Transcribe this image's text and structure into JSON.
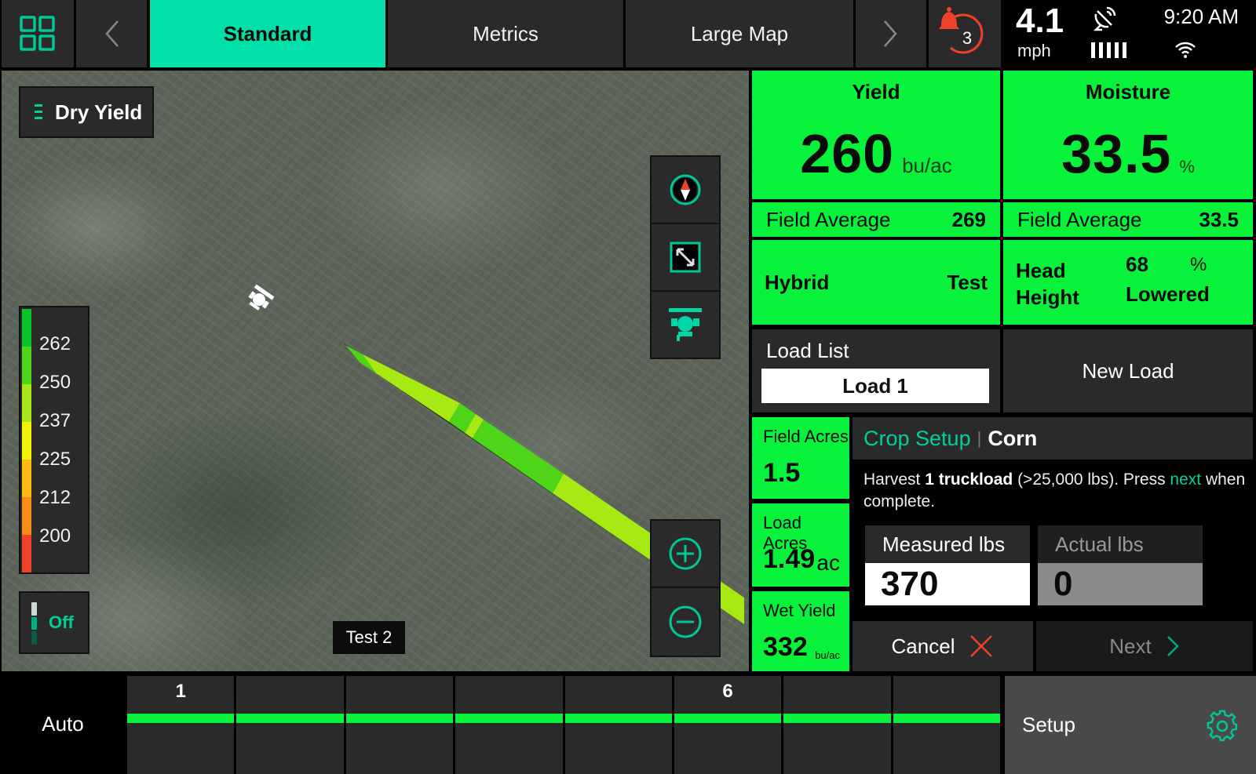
{
  "topbar": {
    "tabs": [
      {
        "label": "Standard",
        "active": true
      },
      {
        "label": "Metrics",
        "active": false
      },
      {
        "label": "Large Map",
        "active": false
      }
    ],
    "alert_count": "3",
    "speed": {
      "value": "4.1",
      "unit": "mph"
    },
    "clock": "9:20 AM",
    "gps_signal_bars": 5
  },
  "map": {
    "layer_label": "Dry Yield",
    "legend": {
      "labels": [
        "262",
        "250",
        "237",
        "225",
        "212",
        "200"
      ],
      "colors": [
        "#0ac22e",
        "#4fd619",
        "#a6e61a",
        "#f2f20a",
        "#fdbb13",
        "#f98a18",
        "#f0412a"
      ]
    },
    "toggle_label": "Off",
    "field_label": "Test 2",
    "swath_colors": {
      "high": "#4ed418",
      "mid": "#a9e913"
    }
  },
  "metrics": {
    "yield": {
      "title": "Yield",
      "value": "260",
      "unit": "bu/ac",
      "avg_label": "Field Average",
      "avg_value": "269"
    },
    "moisture": {
      "title": "Moisture",
      "value": "33.5",
      "unit": "%",
      "avg_label": "Field Average",
      "avg_value": "33.5"
    },
    "hybrid": {
      "label": "Hybrid",
      "value": "Test"
    },
    "head_height": {
      "label_line1": "Head",
      "label_line2": "Height",
      "value": "68",
      "unit": "%",
      "state": "Lowered"
    },
    "field_acres": {
      "label": "Field Acres",
      "value": "1.5"
    },
    "load_acres": {
      "label": "Load Acres",
      "value": "1.49",
      "unit": "ac"
    },
    "wet_yield": {
      "label": "Wet Yield",
      "value": "332",
      "unit": "bu/ac"
    }
  },
  "load": {
    "list_label": "Load List",
    "selected": "Load 1",
    "new_load_label": "New Load"
  },
  "crop_setup": {
    "title": "Crop Setup",
    "crop": "Corn",
    "msg_prefix": "Harvest ",
    "msg_bold": "1 truckload",
    "msg_mid": " (>25,000 lbs). Press ",
    "msg_link": "next",
    "msg_suffix": " when complete.",
    "measured_label": "Measured lbs",
    "measured_value": "370",
    "actual_label": "Actual lbs",
    "actual_value": "0",
    "cancel_label": "Cancel",
    "next_label": "Next"
  },
  "bottombar": {
    "auto_label": "Auto",
    "sections": [
      {
        "num": "1",
        "active": true
      },
      {
        "num": "",
        "active": true
      },
      {
        "num": "",
        "active": true
      },
      {
        "num": "",
        "active": true
      },
      {
        "num": "",
        "active": true
      },
      {
        "num": "6",
        "active": true
      },
      {
        "num": "",
        "active": true
      },
      {
        "num": "",
        "active": true
      }
    ],
    "setup_label": "Setup"
  },
  "colors": {
    "accent": "#00e0a8",
    "tile_green": "#08f23c",
    "alert_red": "#f0412a"
  }
}
